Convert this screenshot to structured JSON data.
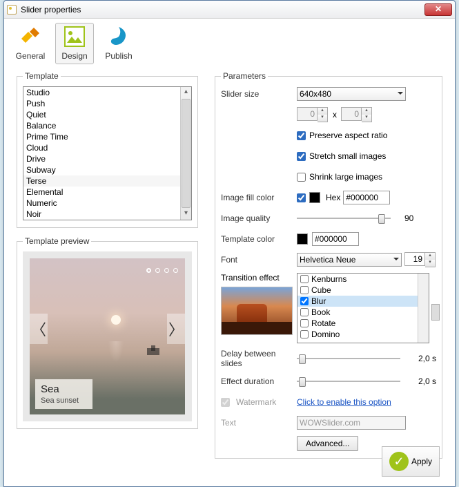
{
  "window": {
    "title": "Slider properties"
  },
  "toolbar": {
    "general": "General",
    "design": "Design",
    "publish": "Publish"
  },
  "template": {
    "legend": "Template",
    "items": [
      "Studio",
      "Push",
      "Quiet",
      "Balance",
      "Prime Time",
      "Cloud",
      "Drive",
      "Subway",
      "Terse",
      "Elemental",
      "Numeric",
      "Noir"
    ],
    "selected": "Terse"
  },
  "preview": {
    "legend": "Template preview",
    "caption_title": "Sea",
    "caption_sub": "Sea sunset"
  },
  "params": {
    "legend": "Parameters",
    "slider_size_label": "Slider size",
    "slider_size_value": "640x480",
    "size_x": "x",
    "size_w": "0",
    "size_h": "0",
    "preserve_label": "Preserve aspect ratio",
    "stretch_label": "Stretch small images",
    "shrink_label": "Shrink large images",
    "fillcolor_label": "Image fill color",
    "hex_label": "Hex",
    "fill_hex": "#000000",
    "quality_label": "Image quality",
    "quality_value": "90",
    "tmplcolor_label": "Template color",
    "tmplcolor_hex": "#000000",
    "font_label": "Font",
    "font_value": "Helvetica Neue",
    "font_size": "19",
    "transition_label": "Transition effect",
    "effects": [
      "Kenburns",
      "Cube",
      "Blur",
      "Book",
      "Rotate",
      "Domino"
    ],
    "effect_selected": "Blur",
    "delay_label": "Delay between slides",
    "delay_value": "2,0 s",
    "effdur_label": "Effect duration",
    "effdur_value": "2,0 s",
    "watermark_label": "Watermark",
    "watermark_link": "Click to enable this option",
    "text_label": "Text",
    "text_value": "WOWSlider.com",
    "advanced_label": "Advanced..."
  },
  "apply": {
    "label": "Apply"
  }
}
